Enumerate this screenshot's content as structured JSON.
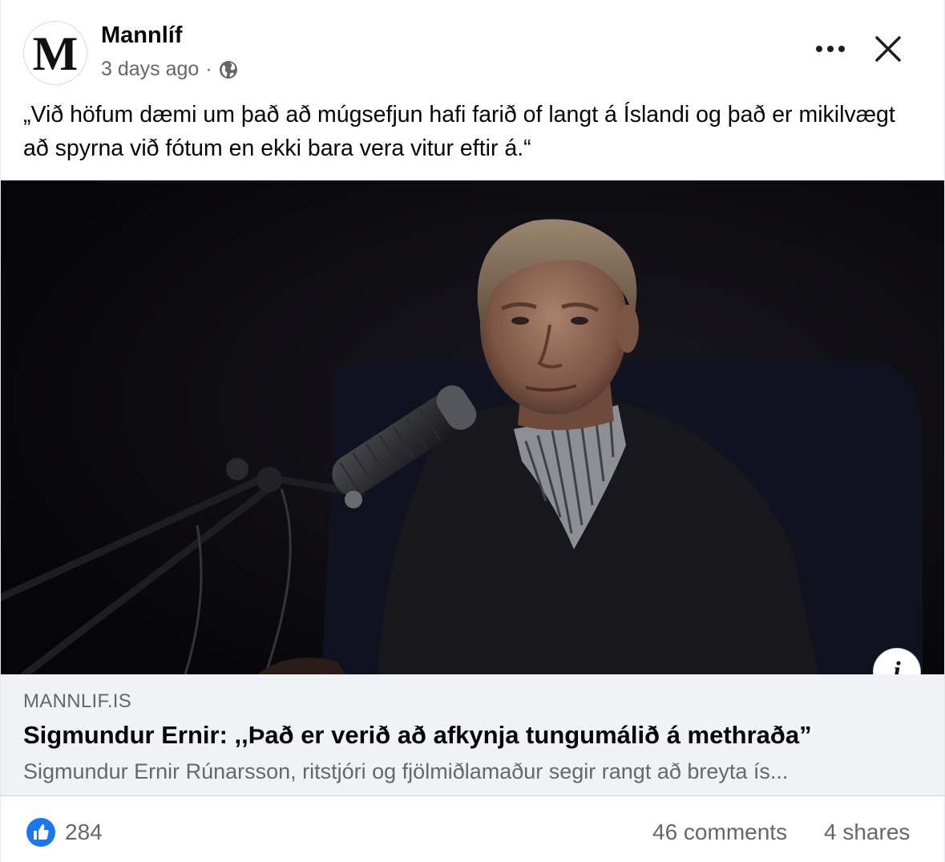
{
  "post": {
    "page_name": "Mannlíf",
    "avatar_letter": "M",
    "timestamp": "3 days ago",
    "separator": "·",
    "text": "„Við höfum dæmi um það að múgsefjun hafi farið of langt á Íslandi og það er mikilvægt að spyrna við fótum en ekki bara vera vitur eftir á.“"
  },
  "icons": {
    "audience": "globe-icon",
    "more": "more-options-icon",
    "close": "close-icon",
    "info": "info-icon",
    "reaction": "like-icon"
  },
  "link_preview": {
    "domain": "MANNLIF.IS",
    "title": "Sigmundur Ernir: ,,Það er verið að afkynja tungumálið á methraða”",
    "description": "Sigmundur Ernir Rúnarsson, ritstjóri og fjölmiðlamaður segir rangt að breyta ís...",
    "info_glyph": "i"
  },
  "engagement": {
    "likes": "284",
    "comments": "46 comments",
    "shares": "4 shares"
  },
  "colors": {
    "like_blue": "#1877f2",
    "secondary_text": "#65676b",
    "link_bg": "#f0f2f5"
  }
}
